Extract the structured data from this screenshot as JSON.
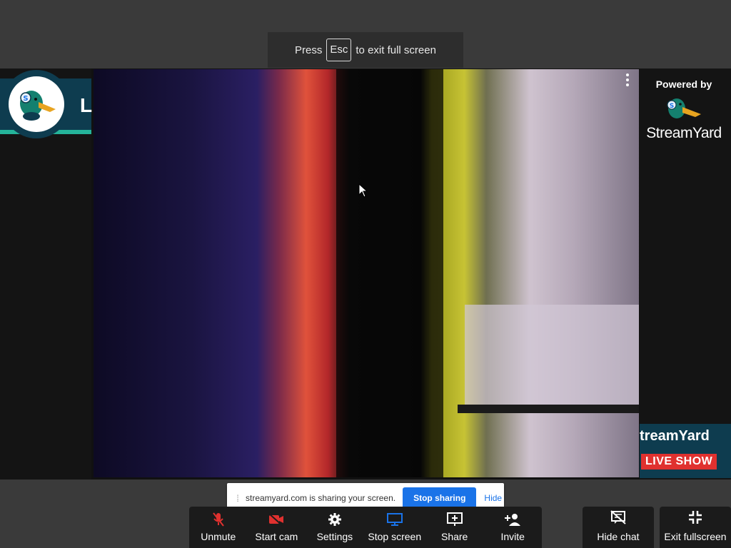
{
  "fullscreen_hint": {
    "prefix": "Press",
    "key": "Esc",
    "suffix": "to exit full screen"
  },
  "overlay": {
    "badge_letter": "L",
    "powered_by": "Powered by",
    "brand_name": "StreamYard",
    "live_wordmark": "treamYard",
    "live_label": "LIVE SHOW"
  },
  "share_banner": {
    "message": "streamyard.com is sharing your screen.",
    "stop_label": "Stop sharing",
    "hide_label": "Hide"
  },
  "controls": [
    {
      "label": "Unmute",
      "icon": "mic-off-icon",
      "color": "#e0312f"
    },
    {
      "label": "Start cam",
      "icon": "camera-off-icon",
      "color": "#e0312f"
    },
    {
      "label": "Settings",
      "icon": "gear-icon",
      "color": "#ffffff"
    },
    {
      "label": "Stop screen",
      "icon": "monitor-icon",
      "color": "#1a73e8"
    },
    {
      "label": "Share",
      "icon": "present-add-icon",
      "color": "#ffffff"
    },
    {
      "label": "Invite",
      "icon": "add-person-icon",
      "color": "#ffffff"
    }
  ],
  "side_buttons": {
    "hide_chat": "Hide chat",
    "exit_fullscreen": "Exit fullscreen"
  },
  "colors": {
    "accent_blue": "#1a73e8",
    "danger_red": "#e0312f",
    "brand_teal": "#0e3c4f",
    "brand_green": "#25b49a"
  }
}
